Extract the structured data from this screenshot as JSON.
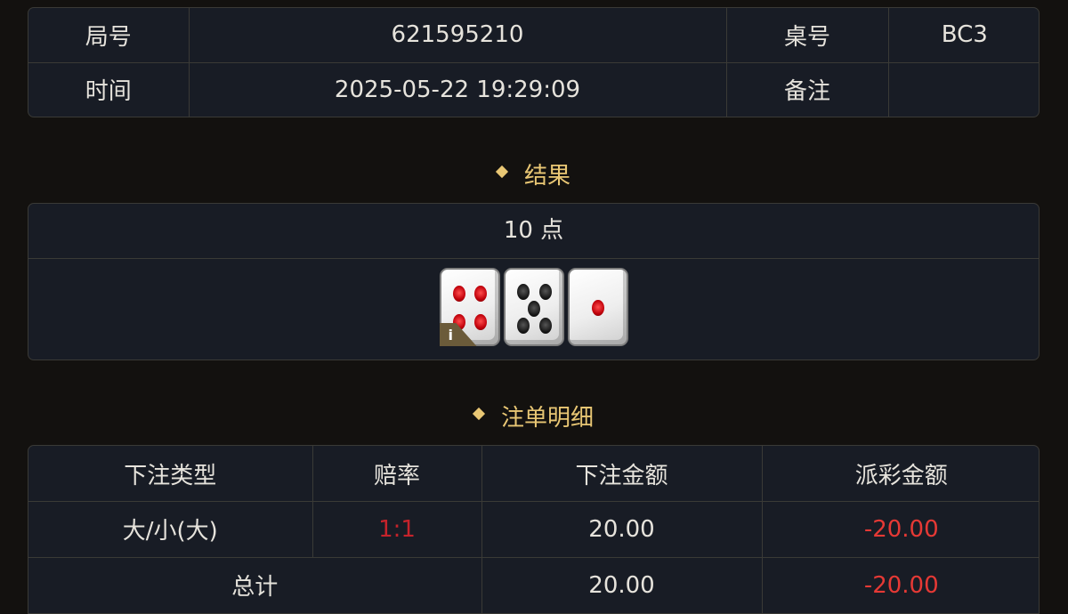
{
  "info": {
    "round_label": "局号",
    "round_value": "621595210",
    "table_label": "桌号",
    "table_value": "BC3",
    "time_label": "时间",
    "time_value": "2025-05-22 19:29:09",
    "note_label": "备注",
    "note_value": ""
  },
  "result": {
    "title": "结果",
    "points_text": "10 点",
    "dice": [
      4,
      5,
      1
    ],
    "info_icon_text": "i"
  },
  "bets": {
    "title": "注单明细",
    "headers": [
      "下注类型",
      "赔率",
      "下注金额",
      "派彩金额"
    ],
    "rows": [
      {
        "type": "大/小(大)",
        "odds": "1:1",
        "amount": "20.00",
        "payout": "-20.00"
      }
    ],
    "total": {
      "label": "总计",
      "amount": "20.00",
      "payout": "-20.00"
    }
  },
  "colors": {
    "accent": "#e9c774",
    "negative": "#e53935",
    "odds": "#c6232b",
    "panel": "#181c25",
    "background": "#13110f"
  }
}
